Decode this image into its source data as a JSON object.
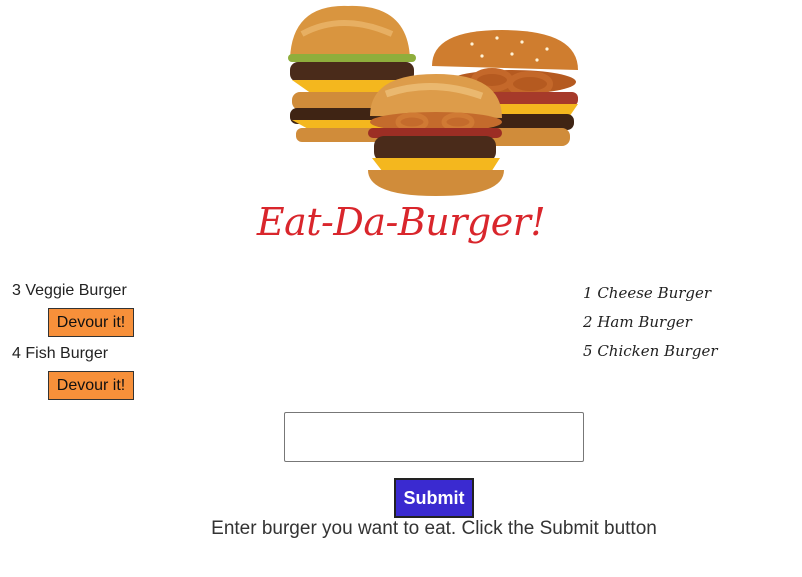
{
  "header": {
    "image_alt": "Three burgers",
    "title": "Eat-Da-Burger!"
  },
  "uneaten": [
    {
      "id": "3",
      "name": "Veggie Burger",
      "button_label": "Devour it!"
    },
    {
      "id": "4",
      "name": "Fish Burger",
      "button_label": "Devour it!"
    }
  ],
  "eaten": [
    {
      "id": "1",
      "name": "Cheese Burger"
    },
    {
      "id": "2",
      "name": "Ham Burger"
    },
    {
      "id": "5",
      "name": "Chicken Burger"
    }
  ],
  "form": {
    "input_value": "",
    "input_placeholder": "",
    "submit_label": "Submit",
    "instructions": "Enter burger you want to eat. Click the Submit button"
  },
  "colors": {
    "title": "#d9262c",
    "devour_button": "#f7903a",
    "submit_button": "#3a2ad0"
  }
}
